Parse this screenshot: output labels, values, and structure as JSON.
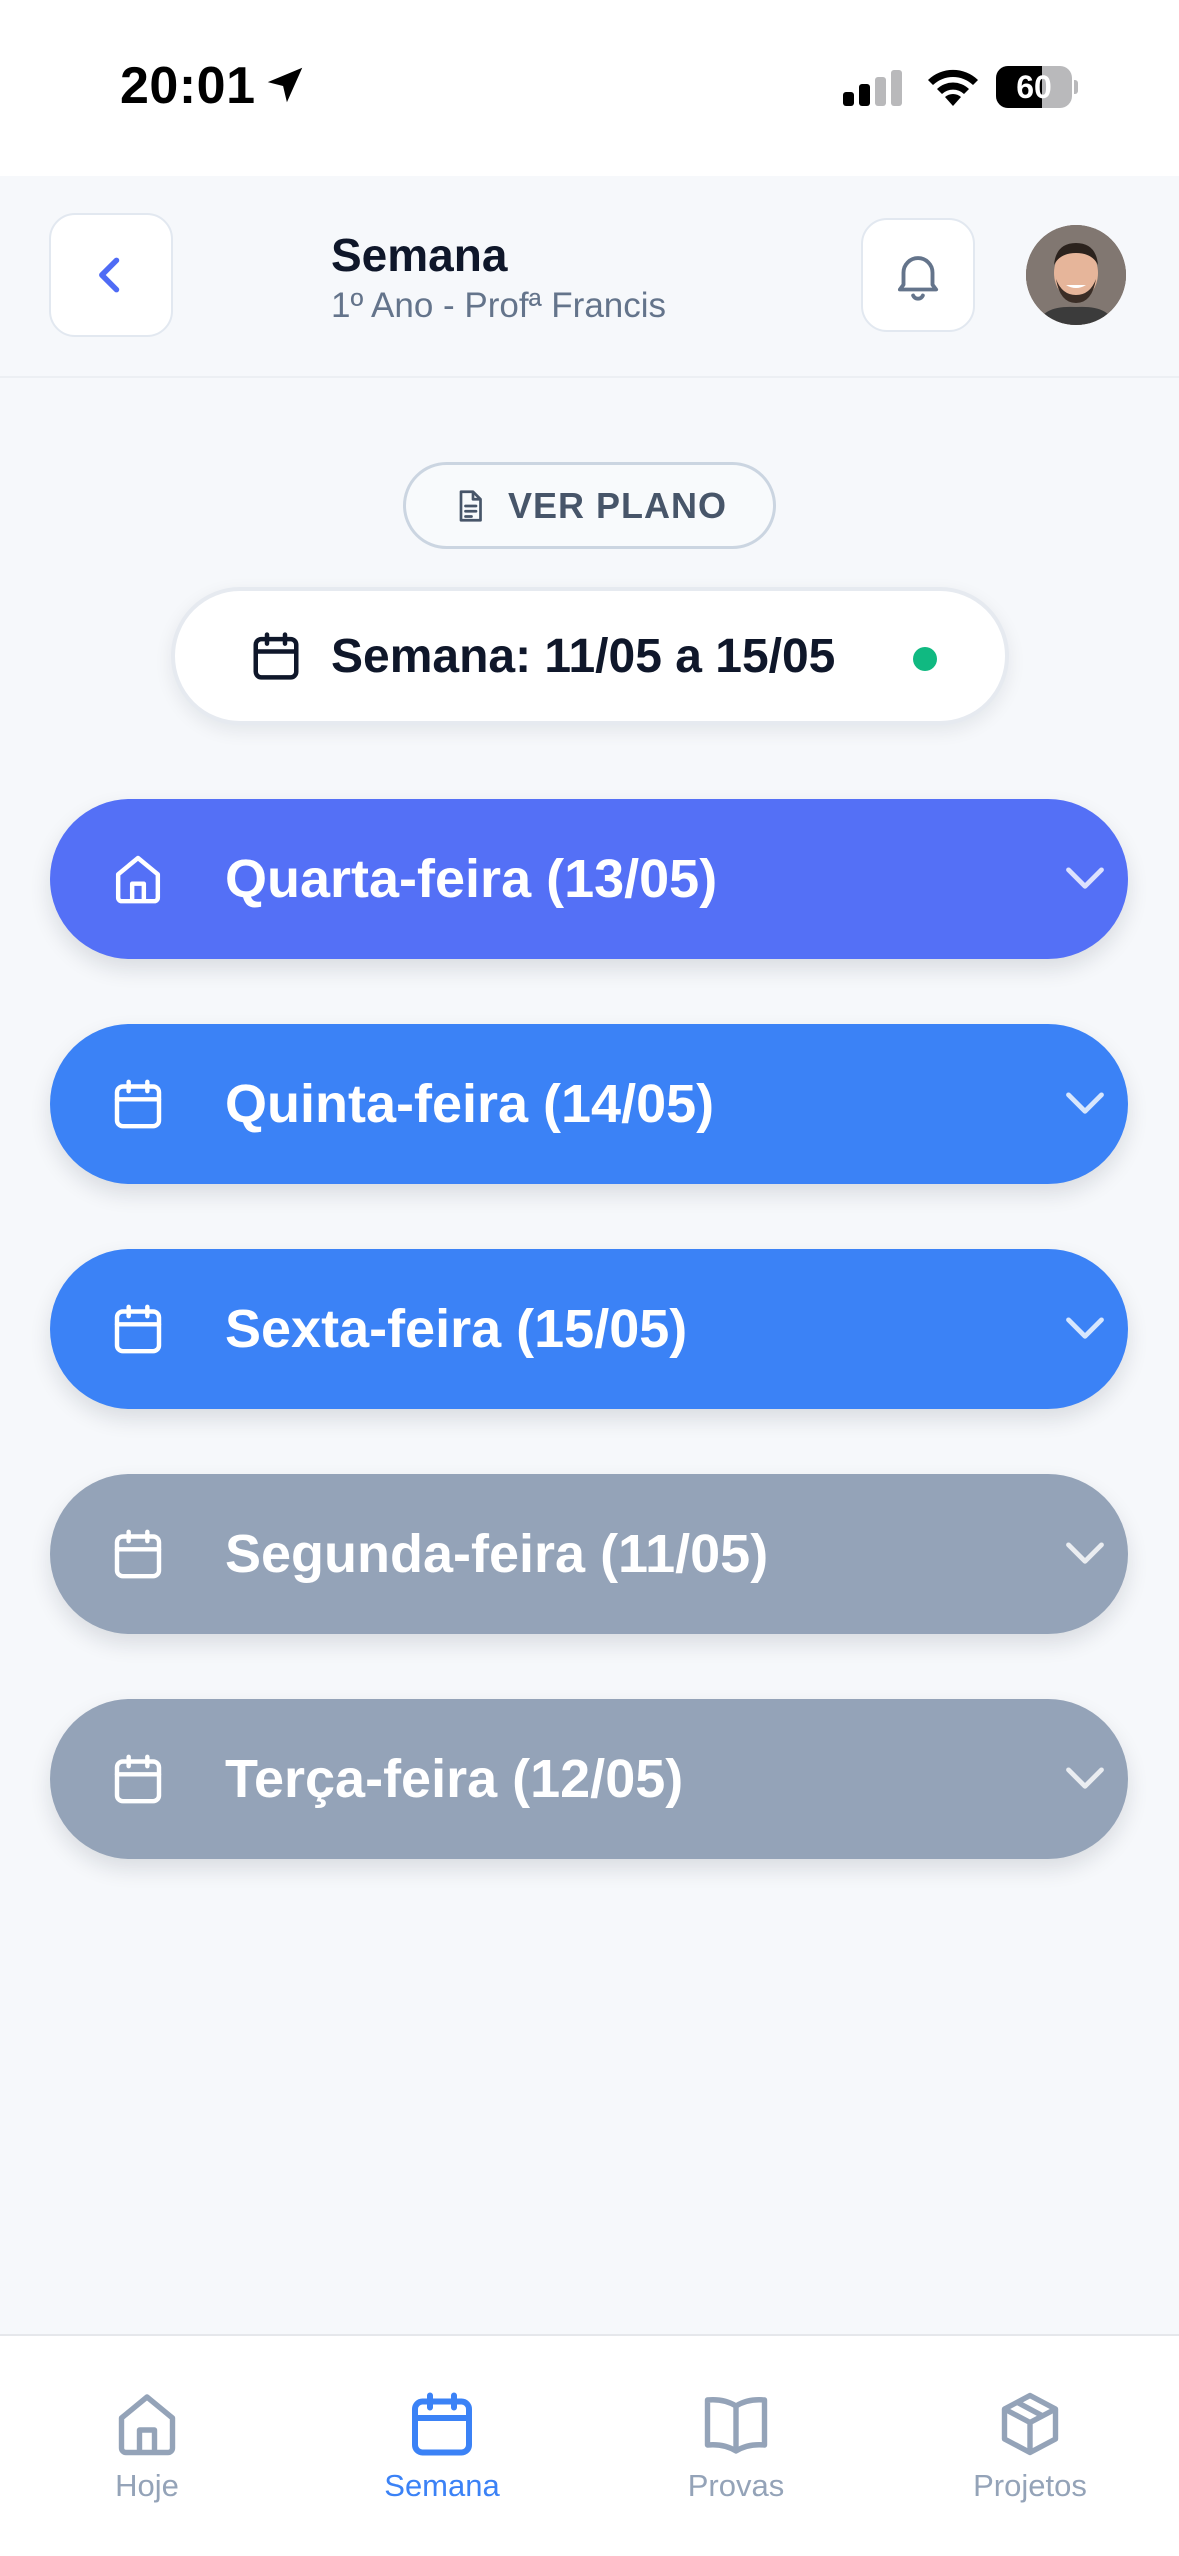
{
  "status_bar": {
    "time": "20:01",
    "battery": "60",
    "battery_level": 0.6
  },
  "header": {
    "title": "Semana",
    "subtitle": "1º Ano - Profª Francis"
  },
  "plan_button": {
    "label": "VER PLANO"
  },
  "week_selector": {
    "label": "Semana: 11/05 a 15/05"
  },
  "days": [
    {
      "label": "Quarta-feira (13/05)",
      "icon": "home-icon",
      "color": "#5470f6"
    },
    {
      "label": "Quinta-feira (14/05)",
      "icon": "calendar-icon",
      "color": "#3b82f6"
    },
    {
      "label": "Sexta-feira (15/05)",
      "icon": "calendar-icon",
      "color": "#3b82f6"
    },
    {
      "label": "Segunda-feira (11/05)",
      "icon": "calendar-icon",
      "color": "#94a3b8"
    },
    {
      "label": "Terça-feira (12/05)",
      "icon": "calendar-icon",
      "color": "#94a3b8"
    }
  ],
  "tabs": [
    {
      "label": "Hoje",
      "icon": "home-icon",
      "active": false
    },
    {
      "label": "Semana",
      "icon": "calendar-icon",
      "active": true
    },
    {
      "label": "Provas",
      "icon": "book-icon",
      "active": false
    },
    {
      "label": "Projetos",
      "icon": "box-icon",
      "active": false
    }
  ],
  "colors": {
    "accent": "#3b82f6",
    "success_dot": "#10b981",
    "inactive": "#94a3b8"
  }
}
